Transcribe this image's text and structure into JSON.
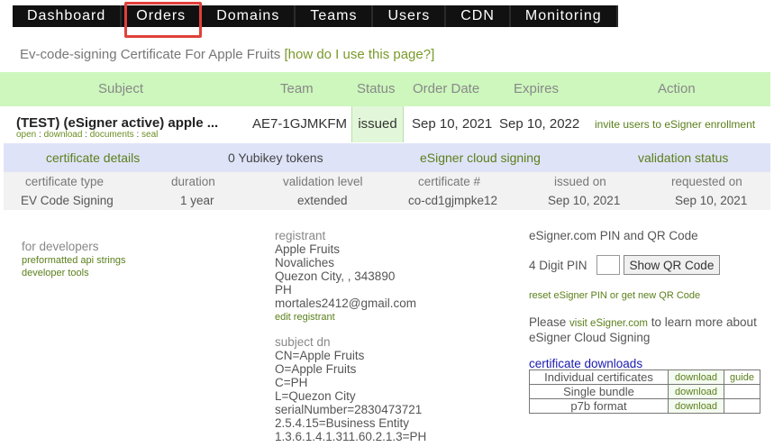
{
  "nav": {
    "items": [
      "Dashboard",
      "Orders",
      "Domains",
      "Teams",
      "Users",
      "CDN",
      "Monitoring"
    ],
    "active": "Orders"
  },
  "page": {
    "title": "Ev-code-signing Certificate For Apple Fruits",
    "help_link": "[how do I use this page?]"
  },
  "order_table": {
    "headers": {
      "subject": "Subject",
      "team": "Team",
      "status": "Status",
      "order_date": "Order Date",
      "expires": "Expires",
      "action": "Action"
    },
    "row": {
      "subject": "(TEST) (eSigner active) apple ...",
      "links": [
        "open",
        "download",
        "documents",
        "seal"
      ],
      "team": "AE7-1GJMKFM",
      "status": "issued",
      "order_date": "Sep 10, 2021",
      "expires": "Sep 10, 2022",
      "action": "invite users to eSigner enrollment"
    }
  },
  "details_band": {
    "certificate_details": "certificate details",
    "yubikey": "0 Yubikey tokens",
    "cloud_signing": "eSigner cloud signing",
    "validation_status": "validation status"
  },
  "cert_table": {
    "headers": [
      "certificate type",
      "duration",
      "validation level",
      "certificate #",
      "issued on",
      "requested on"
    ],
    "values": [
      "EV Code Signing",
      "1 year",
      "extended",
      "co-cd1gjmpke12",
      "Sep 10, 2021",
      "Sep 10, 2021"
    ]
  },
  "developers": {
    "heading": "for developers",
    "links": [
      "preformatted api strings",
      "developer tools"
    ]
  },
  "registrant": {
    "heading": "registrant",
    "lines": [
      "Apple Fruits",
      "Novaliches",
      "Quezon City, , 343890",
      "PH",
      "mortales2412@gmail.com"
    ],
    "edit_link": "edit registrant"
  },
  "subject_dn": {
    "heading": "subject dn",
    "lines": [
      "CN=Apple Fruits",
      "O=Apple Fruits",
      "C=PH",
      "L=Quezon City",
      "serialNumber=2830473721",
      "2.5.4.15=Business Entity",
      "1.3.6.1.4.1.311.60.2.1.3=PH"
    ]
  },
  "esigner": {
    "heading": "eSigner.com PIN and QR Code",
    "pin_label": "4 Digit PIN",
    "pin_value": "",
    "qr_button": "Show QR Code",
    "reset_link": "reset eSigner PIN or get new QR Code",
    "learn_prefix": "Please",
    "learn_link": "visit eSigner.com",
    "learn_suffix": "to learn more about eSigner Cloud Signing"
  },
  "downloads": {
    "title": "certificate downloads",
    "rows": [
      {
        "name": "Individual certificates",
        "download": "download",
        "guide": "guide"
      },
      {
        "name": "Single bundle",
        "download": "download",
        "guide": ""
      },
      {
        "name": "p7b format",
        "download": "download",
        "guide": ""
      }
    ]
  }
}
